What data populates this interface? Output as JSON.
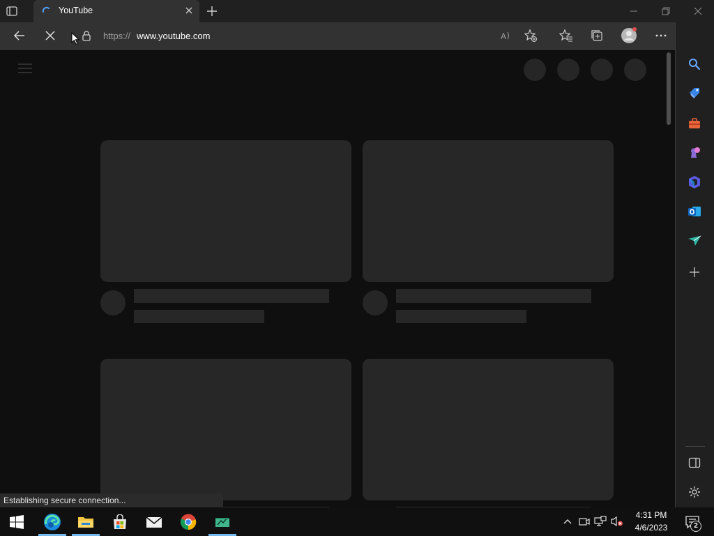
{
  "browser": {
    "tab": {
      "title": "YouTube",
      "favicon": "loading-spinner-icon"
    },
    "address": {
      "scheme": "https://",
      "host": "www.youtube.com"
    },
    "status_text": "Establishing secure connection..."
  },
  "toolbar_icons": [
    "back-arrow-icon",
    "stop-loading-icon",
    "lock-icon",
    "read-aloud-icon",
    "add-favorite-icon",
    "favorites-icon",
    "collections-icon",
    "profile-icon",
    "more-icon",
    "bing-chat-icon"
  ],
  "sidebar_icons": [
    "search-icon",
    "shopping-icon",
    "tools-icon",
    "games-icon",
    "microsoft365-icon",
    "outlook-icon",
    "send-icon",
    "add-icon",
    "hide-sidebar-icon",
    "settings-icon"
  ],
  "taskbar": {
    "apps": [
      "start-icon",
      "edge-icon",
      "file-explorer-icon",
      "store-icon",
      "mail-icon",
      "chrome-icon",
      "app-icon"
    ],
    "time": "4:31 PM",
    "date": "4/6/2023",
    "notification_count": "2"
  },
  "colors": {
    "page_bg": "#0f0f0f",
    "placeholder": "#272727",
    "tab_bg": "#323232",
    "accent_underline": "#76b9ed"
  }
}
